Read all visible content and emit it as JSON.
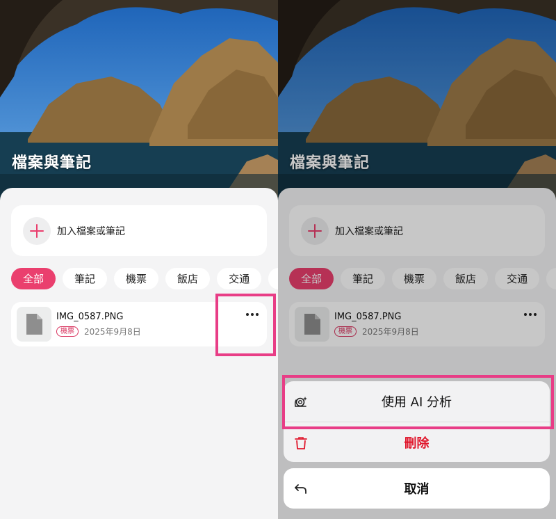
{
  "left": {
    "header": {
      "title": "檔案與筆記"
    },
    "add": {
      "label": "加入檔案或筆記"
    },
    "chips": [
      "全部",
      "筆記",
      "機票",
      "飯店",
      "交通"
    ],
    "file": {
      "name": "IMG_0587.PNG",
      "tag": "機票",
      "date": "2025年9月8日"
    }
  },
  "right": {
    "header": {
      "title": "檔案與筆記"
    },
    "add": {
      "label": "加入檔案或筆記"
    },
    "chips": [
      "全部",
      "筆記",
      "機票",
      "飯店",
      "交通"
    ],
    "file": {
      "name": "IMG_0587.PNG",
      "tag": "機票",
      "date": "2025年9月8日"
    },
    "action_sheet": {
      "analyze_label": "使用 AI 分析",
      "delete_label": "刪除",
      "cancel_label": "取消"
    }
  },
  "colors": {
    "accent": "#ea3f6e",
    "highlight": "#e83d86",
    "danger": "#e0162b"
  },
  "icons": [
    "plus-icon",
    "file-icon",
    "more-icon",
    "ai-snail-icon",
    "trash-icon",
    "undo-arrow-icon"
  ]
}
